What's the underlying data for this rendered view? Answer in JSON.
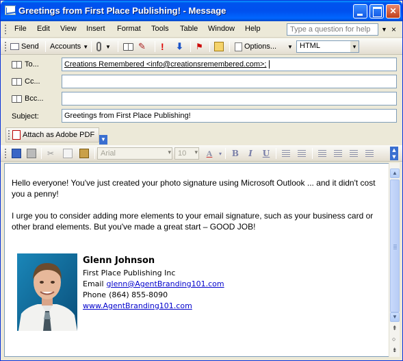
{
  "window": {
    "title": "Greetings from First Place Publishing! - Message"
  },
  "menu": {
    "items": [
      "File",
      "Edit",
      "View",
      "Insert",
      "Format",
      "Tools",
      "Table",
      "Window",
      "Help"
    ],
    "help_placeholder": "Type a question for help"
  },
  "toolbar": {
    "send": "Send",
    "accounts": "Accounts",
    "options": "Options...",
    "message_format": "HTML"
  },
  "fields": {
    "to_label": "To...",
    "cc_label": "Cc...",
    "bcc_label": "Bcc...",
    "subject_label": "Subject:",
    "to_value": "Creations Remembered <info@creationsremembered.com>;",
    "cc_value": "",
    "bcc_value": "",
    "subject_value": "Greetings from First Place Publishing!"
  },
  "attach": {
    "label": "Attach as Adobe PDF"
  },
  "format_toolbar": {
    "font": "Arial",
    "size": "10",
    "bold": "B",
    "italic": "I",
    "underline": "U",
    "font_color": "A"
  },
  "body": {
    "paragraph1": "Hello everyone!  You've just created your photo signature using Microsoft Outlook ... and it didn't cost you a penny!",
    "paragraph2": "I urge you to consider adding more elements to your email signature, such as your business card or other brand elements.  But you've made a great start – GOOD JOB!"
  },
  "signature": {
    "name": "Glenn Johnson",
    "company": "First Place Publishing Inc",
    "email_label": "Email",
    "email": "glenn@AgentBranding101.com",
    "phone_label": "Phone",
    "phone": "(864) 855-8090",
    "website": "www.AgentBranding101.com"
  },
  "colors": {
    "titlebar": "#0054e3",
    "link": "#0000cc",
    "close_button": "#c1401c"
  }
}
